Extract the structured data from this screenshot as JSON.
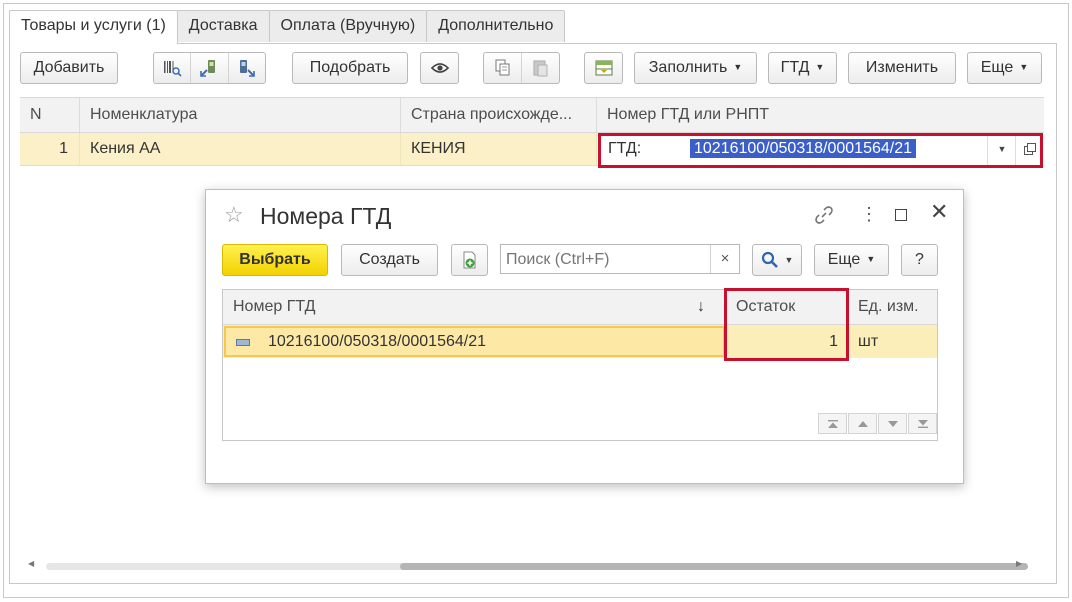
{
  "tabs": [
    {
      "label": "Товары и услуги (1)"
    },
    {
      "label": "Доставка"
    },
    {
      "label": "Оплата (Вручную)"
    },
    {
      "label": "Дополнительно"
    }
  ],
  "toolbar": {
    "add_label": "Добавить",
    "pick_label": "Подобрать",
    "fill_label": "Заполнить",
    "gtd_label": "ГТД",
    "change_label": "Изменить",
    "more_label": "Еще"
  },
  "table": {
    "columns": [
      "N",
      "Номенклатура",
      "Страна происхожде...",
      "Номер ГТД или РНПТ"
    ],
    "rows": [
      {
        "n": "1",
        "item": "Кения АА",
        "country": "КЕНИЯ",
        "gtd_prefix": "ГТД:",
        "gtd_value": "10216100/050318/0001564/21"
      }
    ]
  },
  "dialog": {
    "title": "Номера ГТД",
    "select_label": "Выбрать",
    "create_label": "Создать",
    "search_placeholder": "Поиск (Ctrl+F)",
    "search_clear": "×",
    "more_label": "Еще",
    "help_label": "?",
    "columns": [
      "Номер ГТД",
      "Остаток",
      "Ед. изм."
    ],
    "sort_indicator": "↓",
    "rows": [
      {
        "number": "10216100/050318/0001564/21",
        "balance": "1",
        "unit": "шт"
      }
    ]
  },
  "colors": {
    "highlight_red": "#c8102e",
    "row_selected": "#fbf0c8",
    "primary_button": "#f2d200",
    "text_selection": "#3a5fc9"
  }
}
